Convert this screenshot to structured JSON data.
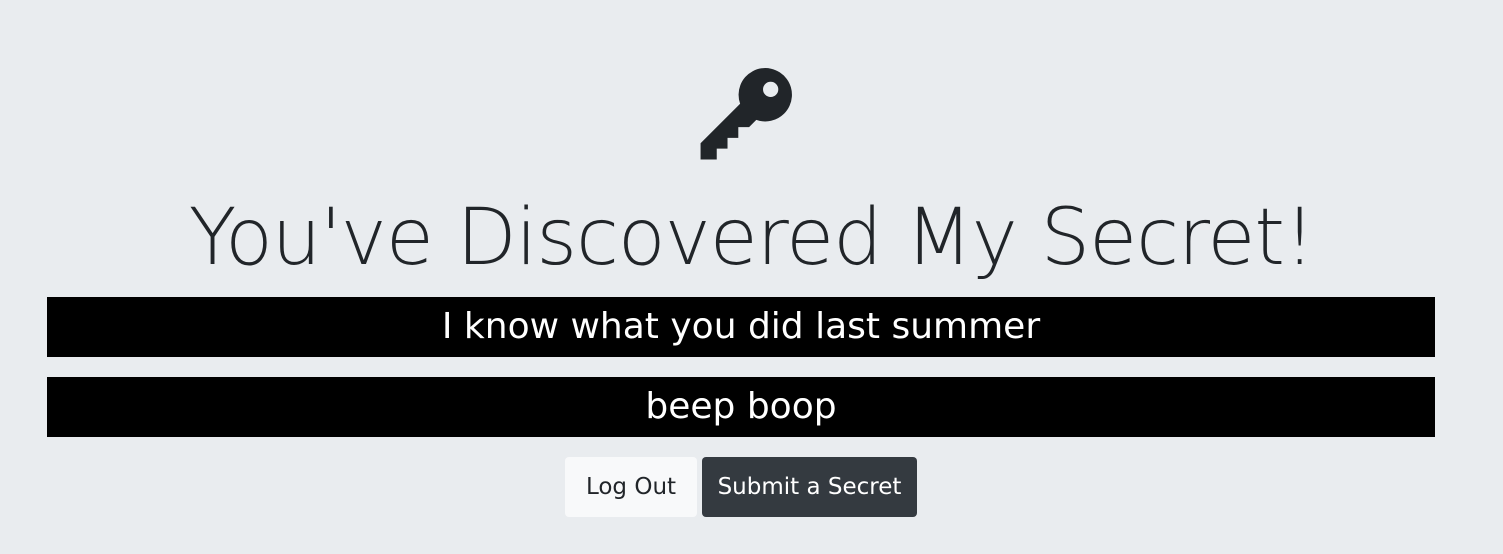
{
  "header": {
    "icon": "key-icon",
    "title": "You've Discovered My Secret!"
  },
  "secrets": [
    "I know what you did last summer",
    "beep boop"
  ],
  "actions": {
    "logout_label": "Log Out",
    "submit_label": "Submit a Secret"
  },
  "colors": {
    "background": "#e9ecef",
    "text": "#212529",
    "secret_bg": "#000000",
    "secret_text": "#ffffff",
    "btn_light": "#f8f9fa",
    "btn_dark": "#343a40"
  }
}
